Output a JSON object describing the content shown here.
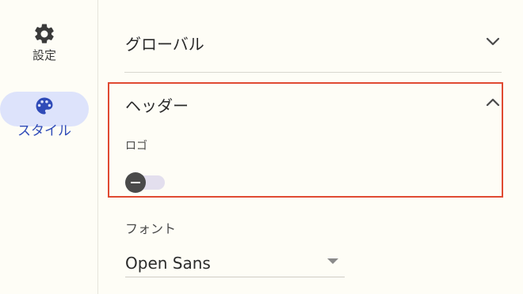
{
  "nav": {
    "settings": {
      "label": "設定",
      "icon": "gear-icon"
    },
    "style": {
      "label": "スタイル",
      "icon": "palette-icon",
      "active": true
    }
  },
  "sections": {
    "global": {
      "title": "グローバル",
      "expanded": false
    },
    "header": {
      "title": "ヘッダー",
      "expanded": true
    }
  },
  "header_settings": {
    "logo_label": "ロゴ",
    "logo_enabled": false
  },
  "font": {
    "label": "フォント",
    "value": "Open Sans"
  },
  "colors": {
    "accent": "#2f4bb8",
    "active_pill": "#dde3fb",
    "highlight_border": "#e04a32"
  }
}
